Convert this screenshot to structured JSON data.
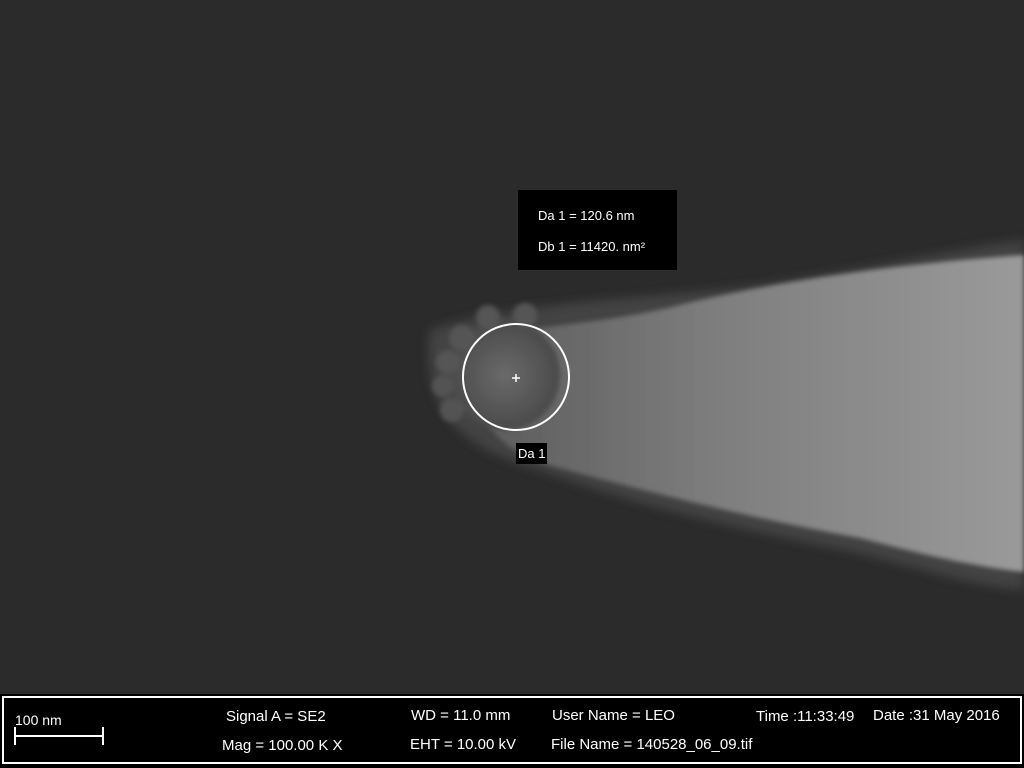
{
  "measurement": {
    "da_label": "Da 1 = 120.6 nm",
    "db_label": "Db 1 = 11420. nm²",
    "marker_label": "Da 1"
  },
  "databar": {
    "scale_bar_label": "100 nm",
    "signal": "Signal A = SE2",
    "magnification": "Mag =  100.00 K X",
    "working_distance": "WD = 11.0 mm",
    "eht": "EHT = 10.00 kV",
    "user_name": "User Name = LEO",
    "file_name": "File Name = 140528_06_09.tif",
    "time": "Time :11:33:49",
    "date": "Date :31 May 2016"
  }
}
